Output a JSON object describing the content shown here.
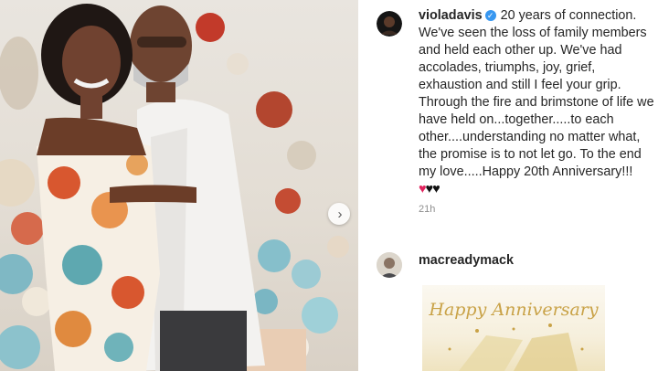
{
  "post": {
    "username": "violadavis",
    "verified": true,
    "caption": "20 years of connection. We've seen the loss of family members and held each other up. We've had accolades, triumphs, joy, grief, exhaustion and still I feel your grip. Through the fire and brimstone of life we have held on...together.....to each other....understanding no matter what, the promise is to not let go. To the end my love.....Happy 20th Anniversary!!!",
    "emoji_hearts": "♥♥♥",
    "timestamp": "21h"
  },
  "comment": {
    "username": "macreadymack",
    "card_text": "Happy Anniversary"
  },
  "icons": {
    "carousel_next": "chevron-right-icon",
    "verified": "verified-badge-icon",
    "like": "heart-outline-icon"
  },
  "colors": {
    "verified_blue": "#3897f0",
    "heart_red": "#e0245e",
    "timestamp_gray": "#8e8e8e",
    "card_gold": "#c9a247"
  }
}
